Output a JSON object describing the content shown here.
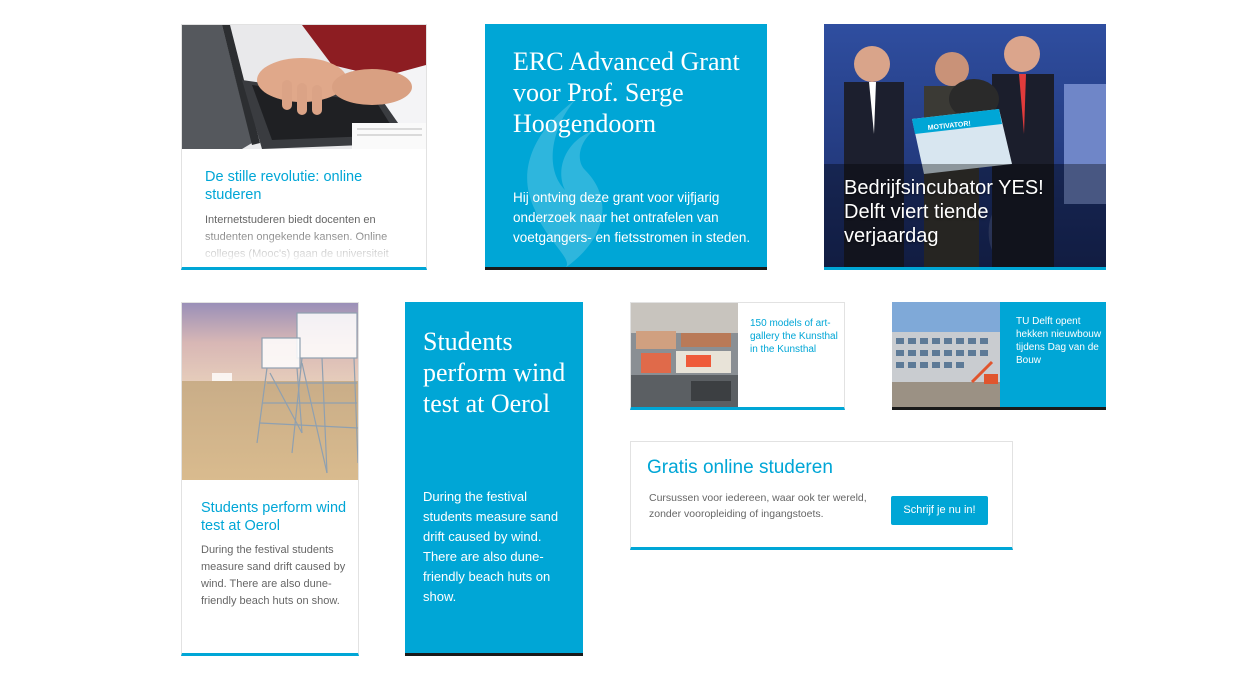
{
  "cards": {
    "stille_revolutie": {
      "title": "De stille revolutie: online studeren",
      "body": "Internetstuderen biedt docenten en studenten ongekende kansen. Online colleges (Mooc's) gaan de universiteit"
    },
    "erc_grant": {
      "title": "ERC Advanced Grant voor Prof. Serge Hoogendoorn",
      "body": "Hij ontving deze grant voor vijfjarig onderzoek naar het ontrafelen van voetgangers- en fietsstromen in steden."
    },
    "yes_delft": {
      "title": "Bedrijfsincubator YES! Delft viert tiende verjaardag",
      "sign_text": "MOTIVATOR!"
    },
    "wind_test_white": {
      "title": "Students perform wind test at Oerol",
      "body": "During the festival students measure sand drift caused by wind. There are also dune-friendly beach huts on show."
    },
    "wind_test_blue": {
      "title": "Students perform wind test at Oerol",
      "body": "During the festival students measure sand drift caused by wind. There are also dune-friendly beach huts on show."
    },
    "kunsthal": {
      "title": "150 models of art-gallery the Kunsthal in the Kunsthal"
    },
    "dag_van_de_bouw": {
      "title": "TU Delft opent hekken nieuwbouw tijdens Dag van de Bouw"
    },
    "gratis_online": {
      "title": "Gratis online studeren",
      "body": "Cursussen voor iedereen, waar ook ter wereld, zonder vooropleiding of ingangstoets.",
      "button": "Schrijf je nu in!"
    }
  },
  "colors": {
    "accent": "#00a6d6",
    "dark_bar": "#1a1a1a",
    "body_text": "#666666"
  }
}
